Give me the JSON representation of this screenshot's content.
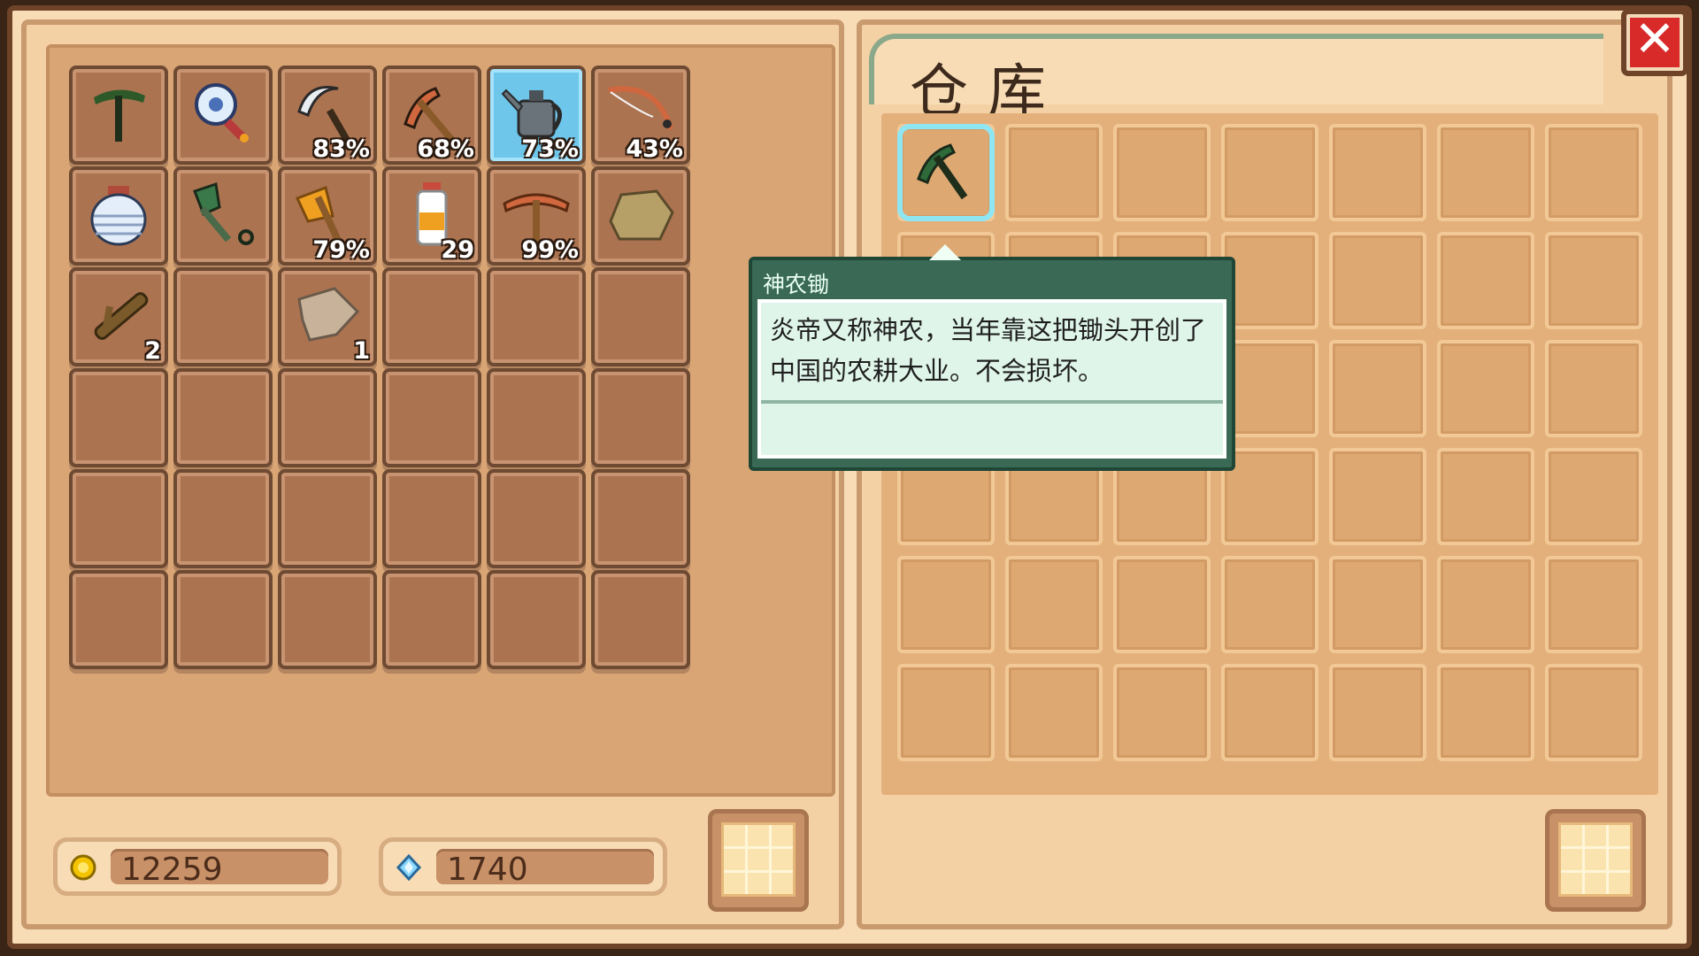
{
  "warehouse": {
    "title": "仓库",
    "close_icon": "close-x-icon"
  },
  "inventory": {
    "slots": [
      {
        "icon": "shennong-hoe-icon",
        "badge": ""
      },
      {
        "icon": "magnifier-gem-icon",
        "badge": ""
      },
      {
        "icon": "sickle-icon",
        "badge": "83%"
      },
      {
        "icon": "pickaxe-icon",
        "badge": "68%"
      },
      {
        "icon": "watering-can-icon",
        "badge": "73%",
        "selected": true
      },
      {
        "icon": "fishing-rod-icon",
        "badge": "43%"
      },
      {
        "icon": "water-jar-icon",
        "badge": ""
      },
      {
        "icon": "shovel-icon",
        "badge": ""
      },
      {
        "icon": "axe-icon",
        "badge": "79%"
      },
      {
        "icon": "milk-bottle-icon",
        "badge": "29"
      },
      {
        "icon": "copper-pickaxe-icon",
        "badge": "99%"
      },
      {
        "icon": "stone-icon",
        "badge": ""
      },
      {
        "icon": "wood-branch-icon",
        "badge": "2"
      },
      {
        "icon": "",
        "badge": ""
      },
      {
        "icon": "cloth-scrap-icon",
        "badge": "1"
      }
    ]
  },
  "currency": {
    "gold": "12259",
    "gems": "1740"
  },
  "tooltip": {
    "item_name": "神农锄",
    "description": "炎帝又称神农，当年靠这把锄头开创了中国的农耕大业。不会损坏。"
  },
  "colors": {
    "panel": "#f4d1a5",
    "slot": "#ac7351",
    "selected_slot": "#6ec6ea",
    "tooltip_header": "#3a6a55",
    "close_button": "#d92a2a"
  }
}
